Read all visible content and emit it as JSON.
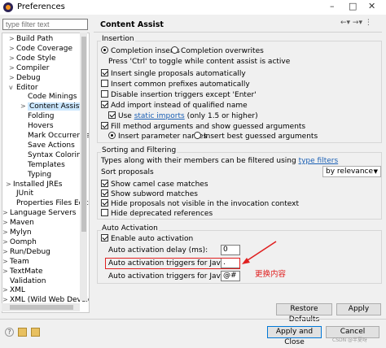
{
  "window": {
    "title": "Preferences"
  },
  "filter": {
    "placeholder": "type filter text"
  },
  "tree": [
    {
      "label": "Build Path",
      "toggle": ">"
    },
    {
      "label": "Code Coverage",
      "toggle": ">"
    },
    {
      "label": "Code Style",
      "toggle": ">"
    },
    {
      "label": "Compiler",
      "toggle": ">"
    },
    {
      "label": "Debug",
      "toggle": ">"
    },
    {
      "label": "Editor",
      "toggle": "v"
    },
    {
      "label": "Code Minings",
      "toggle": ""
    },
    {
      "label": "Content Assist",
      "toggle": ">"
    },
    {
      "label": "Folding",
      "toggle": ""
    },
    {
      "label": "Hovers",
      "toggle": ""
    },
    {
      "label": "Mark Occurrences",
      "toggle": ""
    },
    {
      "label": "Save Actions",
      "toggle": ""
    },
    {
      "label": "Syntax Coloring",
      "toggle": ""
    },
    {
      "label": "Templates",
      "toggle": ""
    },
    {
      "label": "Typing",
      "toggle": ""
    },
    {
      "label": "Installed JREs",
      "toggle": ">"
    },
    {
      "label": "JUnit",
      "toggle": ""
    },
    {
      "label": "Properties Files Editor",
      "toggle": ""
    },
    {
      "label": "Language Servers",
      "toggle": ">"
    },
    {
      "label": "Maven",
      "toggle": ">"
    },
    {
      "label": "Mylyn",
      "toggle": ">"
    },
    {
      "label": "Oomph",
      "toggle": ">"
    },
    {
      "label": "Run/Debug",
      "toggle": ">"
    },
    {
      "label": "Team",
      "toggle": ">"
    },
    {
      "label": "TextMate",
      "toggle": ">"
    },
    {
      "label": "Validation",
      "toggle": ""
    },
    {
      "label": "XML",
      "toggle": ">"
    },
    {
      "label": "XML (Wild Web Developer)",
      "toggle": ">"
    }
  ],
  "page": {
    "title": "Content Assist"
  },
  "insertion": {
    "label": "Insertion",
    "completion_inserts": "Completion inserts",
    "completion_overwrites": "Completion overwrites",
    "hint": "Press 'Ctrl' to toggle while content assist is active",
    "single_proposals": "Insert single proposals automatically",
    "common_prefixes": "Insert common prefixes automatically",
    "disable_triggers": "Disable insertion triggers except 'Enter'",
    "add_import": "Add import instead of qualified name",
    "use": "Use",
    "static_imports": "static imports",
    "only_15": "(only 1.5 or higher)",
    "fill_args": "Fill method arguments and show guessed arguments",
    "insert_param_names": "Insert parameter names",
    "insert_best_guessed": "Insert best guessed arguments"
  },
  "sorting": {
    "label": "Sorting and Filtering",
    "types_text": "Types along with their members can be filtered using",
    "type_filters": "type filters",
    "sort_proposals": "Sort proposals",
    "sort_value": "by relevance",
    "camel_case": "Show camel case matches",
    "subword": "Show subword matches",
    "hide_not_visible": "Hide proposals not visible in the invocation context",
    "hide_deprecated": "Hide deprecated references"
  },
  "auto": {
    "label": "Auto Activation",
    "enable": "Enable auto activation",
    "delay_label": "Auto activation delay (ms):",
    "delay_value": "0",
    "java_label": "Auto activation triggers for Java:",
    "java_value": ".",
    "javadoc_label": "Auto activation triggers for Javadoc:",
    "javadoc_value": "@#"
  },
  "annotation": {
    "text": "更换内容"
  },
  "buttons": {
    "restore": "Restore Defaults",
    "apply": "Apply",
    "apply_close": "Apply and Close",
    "cancel": "Cancel"
  },
  "watermark": "CSDN @半夏呀"
}
